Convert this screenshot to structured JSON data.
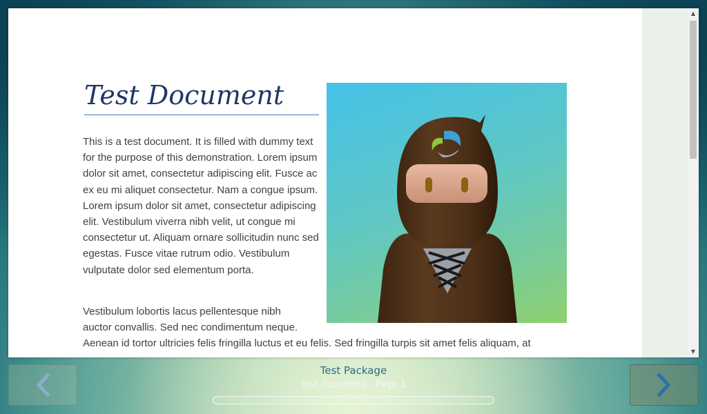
{
  "document": {
    "title": "Test Document",
    "paragraph1": "This is a test document. It is filled with dummy text for the purpose of this demonstration. Lorem ipsum dolor sit amet, consectetur adipiscing elit. Fusce ac ex eu mi aliquet consectetur. Nam a congue ipsum. Lorem ipsum dolor sit amet, consectetur adipiscing elit. Vestibulum viverra nibh velit, ut congue mi consectetur ut. Aliquam ornare sollicitudin nunc sed egestas. Fusce vitae rutrum odio. Vestibulum vulputate dolor sed elementum porta.",
    "paragraph2_short": "Vestibulum lobortis lacus pellentesque nibh auctor convallis. Sed nec condimentum neque.",
    "paragraph2_rest": "Aenean id tortor ultricies felis fringilla luctus et eu felis. Sed fringilla turpis sit amet felis aliquam, at",
    "image_icon": "ninja-mascot-illustration"
  },
  "footer": {
    "package_title": "Test Package",
    "page_label": "test document - Page 1",
    "progress": 0,
    "prev_icon": "chevron-left-icon",
    "next_icon": "chevron-right-icon"
  },
  "scrollbar": {
    "up_icon": "▲",
    "down_icon": "▼"
  },
  "colors": {
    "title": "#1f3864",
    "body_text": "#404040",
    "package_title": "#2d6b87",
    "side_panel": "#e9f1ea"
  }
}
